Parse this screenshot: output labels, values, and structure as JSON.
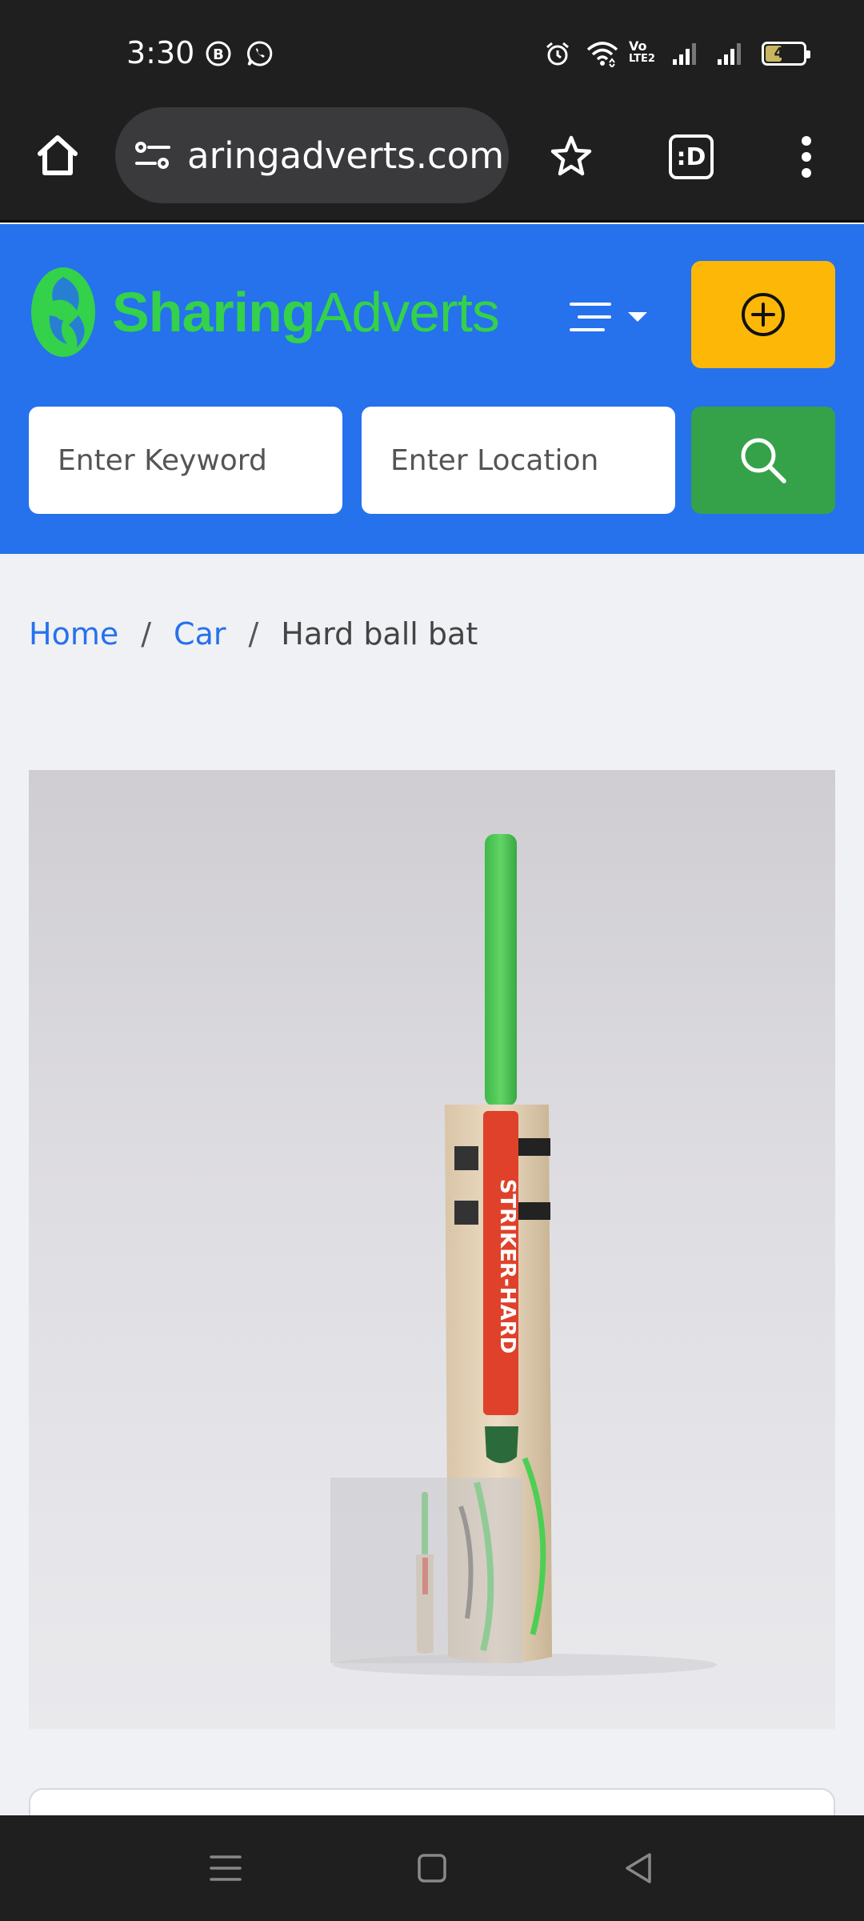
{
  "status_bar": {
    "time": "3:30",
    "battery_level": "44",
    "battery_fraction": 0.44,
    "icons": [
      "b-notification-icon",
      "whatsapp-icon",
      "alarm-icon",
      "wifi-icon",
      "volte-icon",
      "signal-icon",
      "signal-icon",
      "battery-icon"
    ],
    "volte_label_top": "Vo",
    "volte_label_bottom": "LTE2"
  },
  "browser": {
    "url": "aringadverts.com",
    "home_icon": "home-icon",
    "site_info_icon": "site-settings-icon",
    "bookmark_icon": "star-icon",
    "tabs_label": ":D",
    "menu_icon": "more-vert-icon"
  },
  "site": {
    "brand_part1": "Sharing",
    "brand_part2": "Adverts",
    "brand_color": "#34d14a",
    "header_color": "#2671ec",
    "post_button_color": "#fdb707",
    "search_button_color": "#35a24a",
    "keyword_placeholder": "Enter Keyword",
    "location_placeholder": "Enter Location"
  },
  "breadcrumb": {
    "items": [
      {
        "label": "Home"
      },
      {
        "label": "Car"
      }
    ],
    "separator": "/",
    "current": "Hard ball bat"
  },
  "product": {
    "bat_brand_text": "STRIKER-HARD"
  }
}
